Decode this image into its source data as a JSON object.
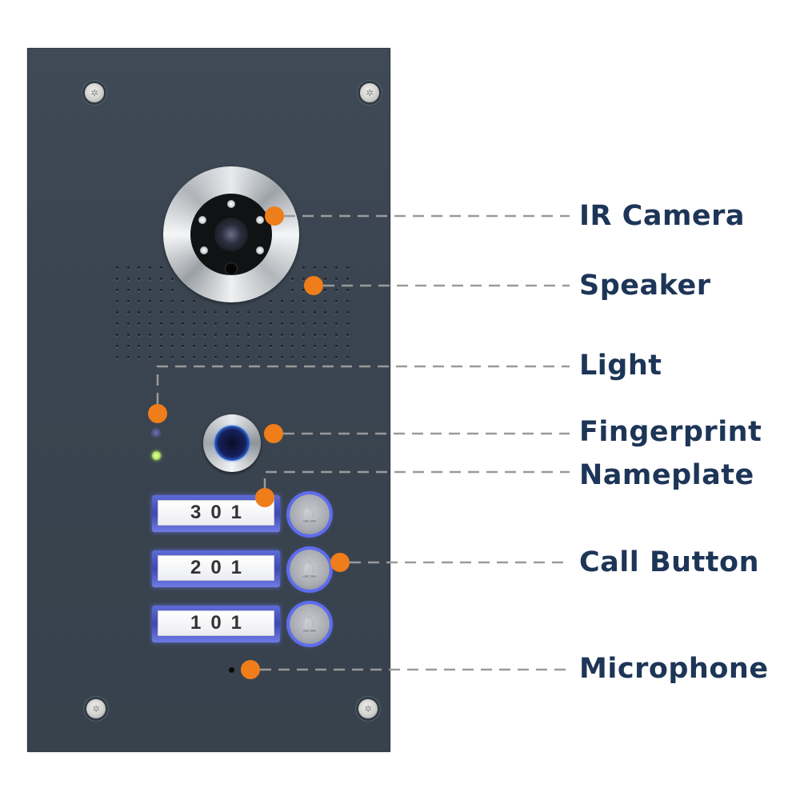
{
  "diagram": {
    "subject": "Video door intercom panel",
    "accent_color": "#ef7d1a",
    "label_color": "#1d3557",
    "panel_color": "#3c4651",
    "callouts": [
      {
        "id": "ir-camera",
        "label": "IR Camera"
      },
      {
        "id": "speaker",
        "label": "Speaker"
      },
      {
        "id": "light",
        "label": "Light"
      },
      {
        "id": "fingerprint",
        "label": "Fingerprint"
      },
      {
        "id": "nameplate",
        "label": "Nameplate"
      },
      {
        "id": "call-button",
        "label": "Call Button"
      },
      {
        "id": "microphone",
        "label": "Microphone"
      }
    ],
    "nameplates": [
      {
        "text": "301"
      },
      {
        "text": "201"
      },
      {
        "text": "101"
      }
    ],
    "icons": {
      "screw": "torx-screw-icon",
      "call_button": "bell-icon",
      "fingerprint": "fingerprint-sensor-icon"
    }
  }
}
